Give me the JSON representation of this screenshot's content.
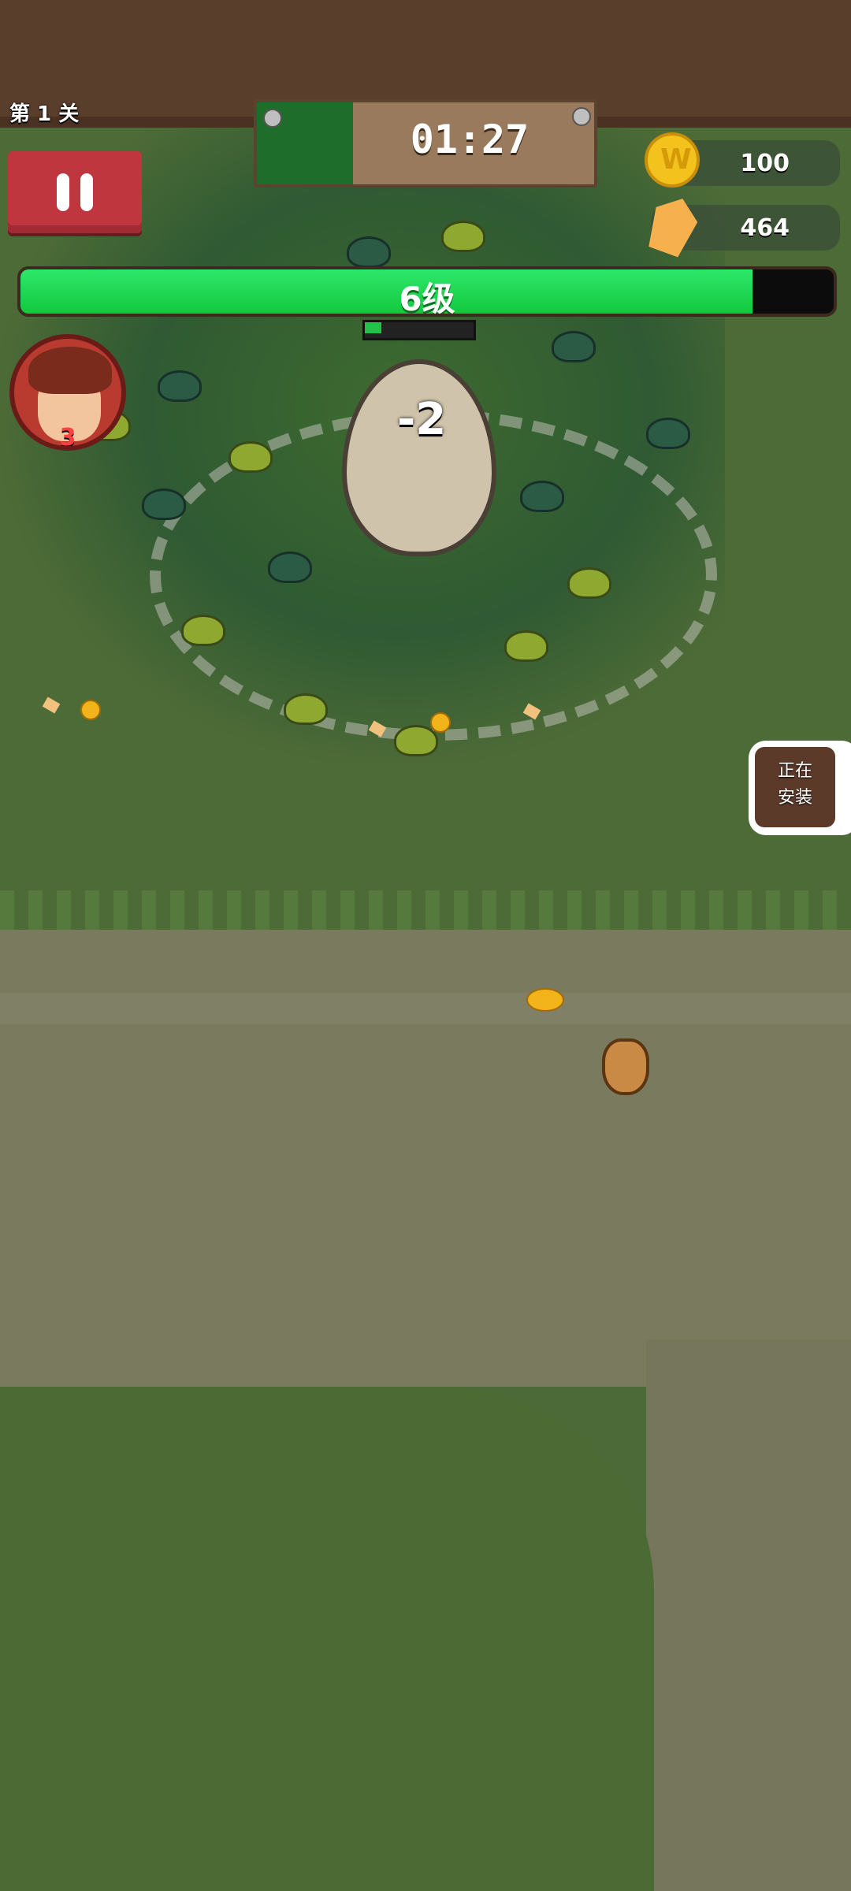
{
  "hud": {
    "level_label": "第 1 关",
    "timer": "01:27",
    "coins": "100",
    "gems": "464",
    "xp": {
      "label": "6级",
      "progress": 0.9
    },
    "avatar_count": "3"
  },
  "world": {
    "damage_text": "-2",
    "egg_hp_progress": 0.16
  },
  "install_widget": {
    "line1": "正在",
    "line2": "安装"
  },
  "icons": [
    "pause-icon",
    "coin-icon",
    "gem-icon",
    "hero-avatar",
    "pot-icon"
  ],
  "colors": {
    "xp_fill": "#12c83e",
    "pause_button": "#c0363f",
    "top_bar": "#5a3e2c"
  }
}
